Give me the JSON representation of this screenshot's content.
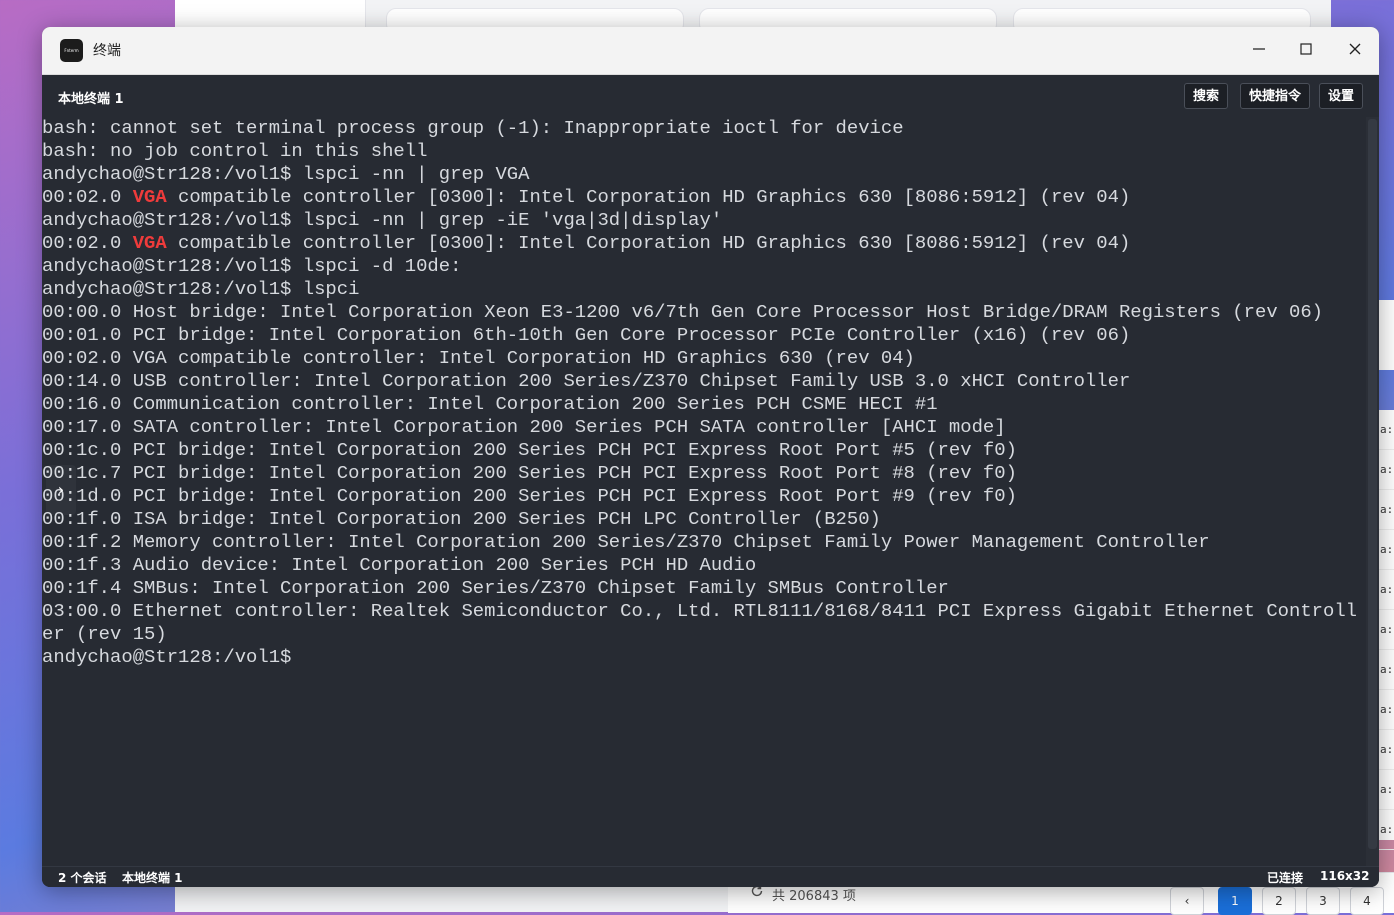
{
  "window": {
    "title": "终端",
    "app_icon_text": "Fnterm"
  },
  "toolbar": {
    "session_name": "本地终端 1",
    "search_label": "搜索",
    "shortcuts_label": "快捷指令",
    "settings_label": "设置"
  },
  "terminal": {
    "lines": [
      "bash: cannot set terminal process group (-1): Inappropriate ioctl for device",
      "bash: no job control in this shell",
      "andychao@Str128:/vol1$ lspci -nn | grep VGA",
      "00:02.0 VGA compatible controller [0300]: Intel Corporation HD Graphics 630 [8086:5912] (rev 04)",
      "andychao@Str128:/vol1$ lspci -nn | grep -iE 'vga|3d|display'",
      "00:02.0 VGA compatible controller [0300]: Intel Corporation HD Graphics 630 [8086:5912] (rev 04)",
      "andychao@Str128:/vol1$ lspci -d 10de:",
      "andychao@Str128:/vol1$ lspci",
      "00:00.0 Host bridge: Intel Corporation Xeon E3-1200 v6/7th Gen Core Processor Host Bridge/DRAM Registers (rev 06)",
      "00:01.0 PCI bridge: Intel Corporation 6th-10th Gen Core Processor PCIe Controller (x16) (rev 06)",
      "00:02.0 VGA compatible controller: Intel Corporation HD Graphics 630 (rev 04)",
      "00:14.0 USB controller: Intel Corporation 200 Series/Z370 Chipset Family USB 3.0 xHCI Controller",
      "00:16.0 Communication controller: Intel Corporation 200 Series PCH CSME HECI #1",
      "00:17.0 SATA controller: Intel Corporation 200 Series PCH SATA controller [AHCI mode]",
      "00:1c.0 PCI bridge: Intel Corporation 200 Series PCH PCI Express Root Port #5 (rev f0)",
      "00:1c.7 PCI bridge: Intel Corporation 200 Series PCH PCI Express Root Port #8 (rev f0)",
      "00:1d.0 PCI bridge: Intel Corporation 200 Series PCH PCI Express Root Port #9 (rev f0)",
      "00:1f.0 ISA bridge: Intel Corporation 200 Series PCH LPC Controller (B250)",
      "00:1f.2 Memory controller: Intel Corporation 200 Series/Z370 Chipset Family Power Management Controller",
      "00:1f.3 Audio device: Intel Corporation 200 Series PCH HD Audio",
      "00:1f.4 SMBus: Intel Corporation 200 Series/Z370 Chipset Family SMBus Controller",
      "03:00.0 Ethernet controller: Realtek Semiconductor Co., Ltd. RTL8111/8168/8411 PCI Express Gigabit Ethernet Controll",
      "er (rev 15)",
      "andychao@Str128:/vol1$ "
    ],
    "highlight_term": "VGA",
    "highlight_lines": [
      3,
      5
    ],
    "highlight_color": "#ef3b3b",
    "text_color": "#d6d9de",
    "background": "#272b33"
  },
  "statusbar": {
    "sessions": "2 个会话",
    "current_session": "本地终端 1",
    "connection": "已连接",
    "size": "116x32"
  },
  "background_app": {
    "total_text": "共 206843 项",
    "pages": [
      "1",
      "2",
      "3",
      "4"
    ],
    "active_page": "1",
    "side_text": "a:s"
  }
}
